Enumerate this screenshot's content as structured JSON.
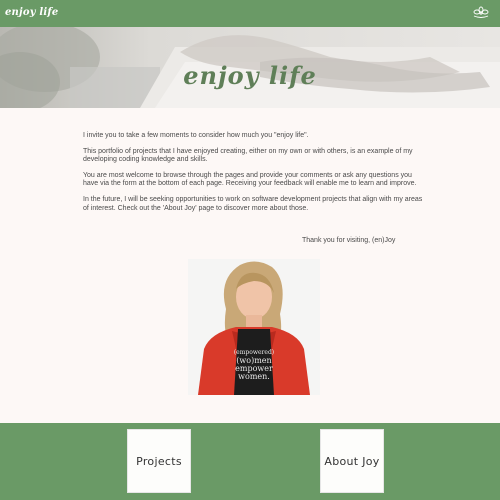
{
  "header": {
    "brand": "enjoy life"
  },
  "hero": {
    "title": "enjoy life"
  },
  "intro": {
    "paragraphs": [
      "I invite you to take a few moments to consider how much you \"enjoy life\".",
      "This portfolio of projects that I have enjoyed creating, either on my own or with others, is an example of my developing coding knowledge and skills.",
      "You are most welcome to browse through the pages and provide your comments or ask any questions you have via the form at the bottom of each page. Receiving your feedback will enable me to learn and improve.",
      "In the future, I will be seeking opportunities to work on software development projects that align with my areas of interest. Check out the 'About Joy' page to discover more about those."
    ],
    "signoff": "Thank you for visiting, (en)Joy"
  },
  "portrait": {
    "shirt_text": [
      "(empowered)",
      "(wo)men",
      "empower",
      "women."
    ]
  },
  "nav": {
    "projects_label": "Projects",
    "about_label": "About Joy"
  }
}
